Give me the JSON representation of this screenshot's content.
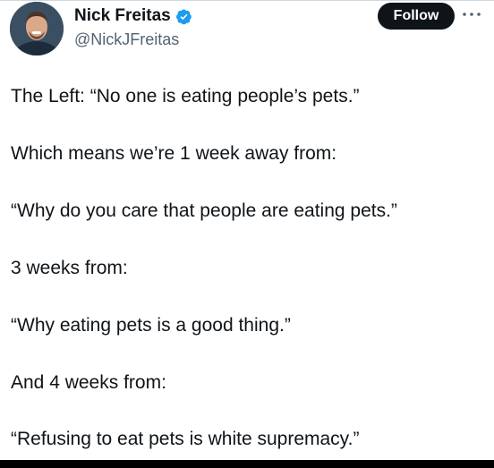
{
  "author": {
    "name": "Nick Freitas",
    "handle": "@NickJFreitas",
    "verified_icon": "verified-badge-icon",
    "verified_color": "#1d9bf0"
  },
  "actions": {
    "follow_label": "Follow",
    "more_icon": "more-dots-icon"
  },
  "tweet": {
    "paragraphs": [
      "The Left: “No one is eating people’s pets.”",
      "Which means we’re  1 week away from:",
      "“Why do you care that people are eating pets.”",
      "3 weeks from:",
      "“Why eating pets is a good thing.”",
      "And 4 weeks from:",
      "“Refusing to eat pets is white supremacy.”"
    ]
  },
  "colors": {
    "text": "#0f1419",
    "secondary_text": "#536471",
    "button_bg": "#0f1419",
    "button_text": "#ffffff"
  }
}
